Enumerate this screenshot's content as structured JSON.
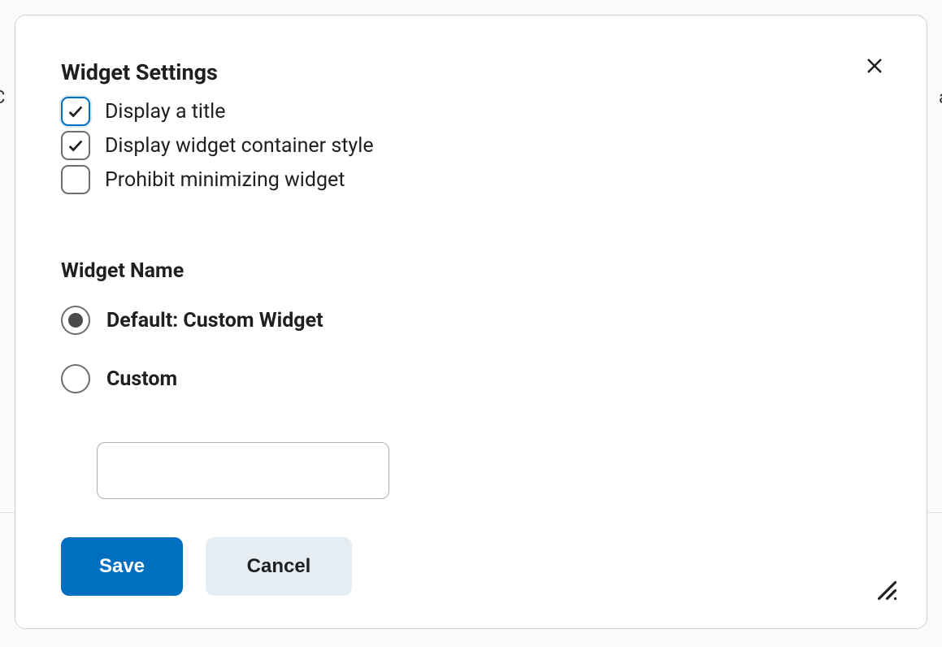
{
  "dialog": {
    "title": "Widget Settings",
    "checkboxes": [
      {
        "label": "Display a title",
        "checked": true,
        "focused": true
      },
      {
        "label": "Display widget container style",
        "checked": true,
        "focused": false
      },
      {
        "label": "Prohibit minimizing widget",
        "checked": false,
        "focused": false
      }
    ],
    "widgetName": {
      "section_label": "Widget Name",
      "options": [
        {
          "label": "Default: Custom Widget",
          "selected": true
        },
        {
          "label": "Custom",
          "selected": false
        }
      ],
      "custom_value": ""
    },
    "buttons": {
      "save": "Save",
      "cancel": "Cancel"
    }
  }
}
